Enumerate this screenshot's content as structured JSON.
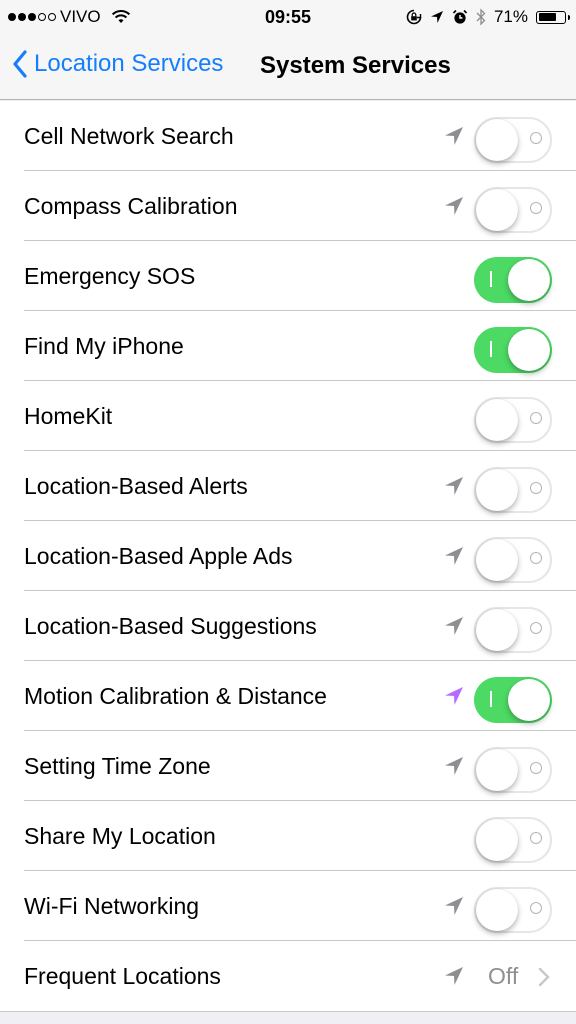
{
  "status_bar": {
    "signal_filled": 3,
    "signal_total": 5,
    "carrier": "VIVO",
    "time": "09:55",
    "battery_percent_label": "71%",
    "battery_level": 0.71,
    "icons": [
      "wifi-icon",
      "orientation-lock-icon",
      "location-icon",
      "alarm-icon",
      "bluetooth-icon",
      "battery-icon"
    ]
  },
  "nav": {
    "back_label": "Location Services",
    "title": "System Services"
  },
  "colors": {
    "accent": "#157efb",
    "toggle_on": "#4cd964",
    "location_active": "#b66dff",
    "location_recent": "#8e8e93"
  },
  "rows": [
    {
      "label": "Cell Network Search",
      "location_icon": "gray",
      "on": false
    },
    {
      "label": "Compass Calibration",
      "location_icon": "gray",
      "on": false
    },
    {
      "label": "Emergency SOS",
      "location_icon": "none",
      "on": true
    },
    {
      "label": "Find My iPhone",
      "location_icon": "none",
      "on": true
    },
    {
      "label": "HomeKit",
      "location_icon": "none",
      "on": false
    },
    {
      "label": "Location-Based Alerts",
      "location_icon": "gray",
      "on": false
    },
    {
      "label": "Location-Based Apple Ads",
      "location_icon": "gray",
      "on": false
    },
    {
      "label": "Location-Based Suggestions",
      "location_icon": "gray",
      "on": false
    },
    {
      "label": "Motion Calibration & Distance",
      "location_icon": "purple",
      "on": true
    },
    {
      "label": "Setting Time Zone",
      "location_icon": "gray",
      "on": false
    },
    {
      "label": "Share My Location",
      "location_icon": "none",
      "on": false
    },
    {
      "label": "Wi-Fi Networking",
      "location_icon": "gray",
      "on": false
    }
  ],
  "detail_row": {
    "label": "Frequent Locations",
    "location_icon": "gray",
    "value": "Off"
  }
}
